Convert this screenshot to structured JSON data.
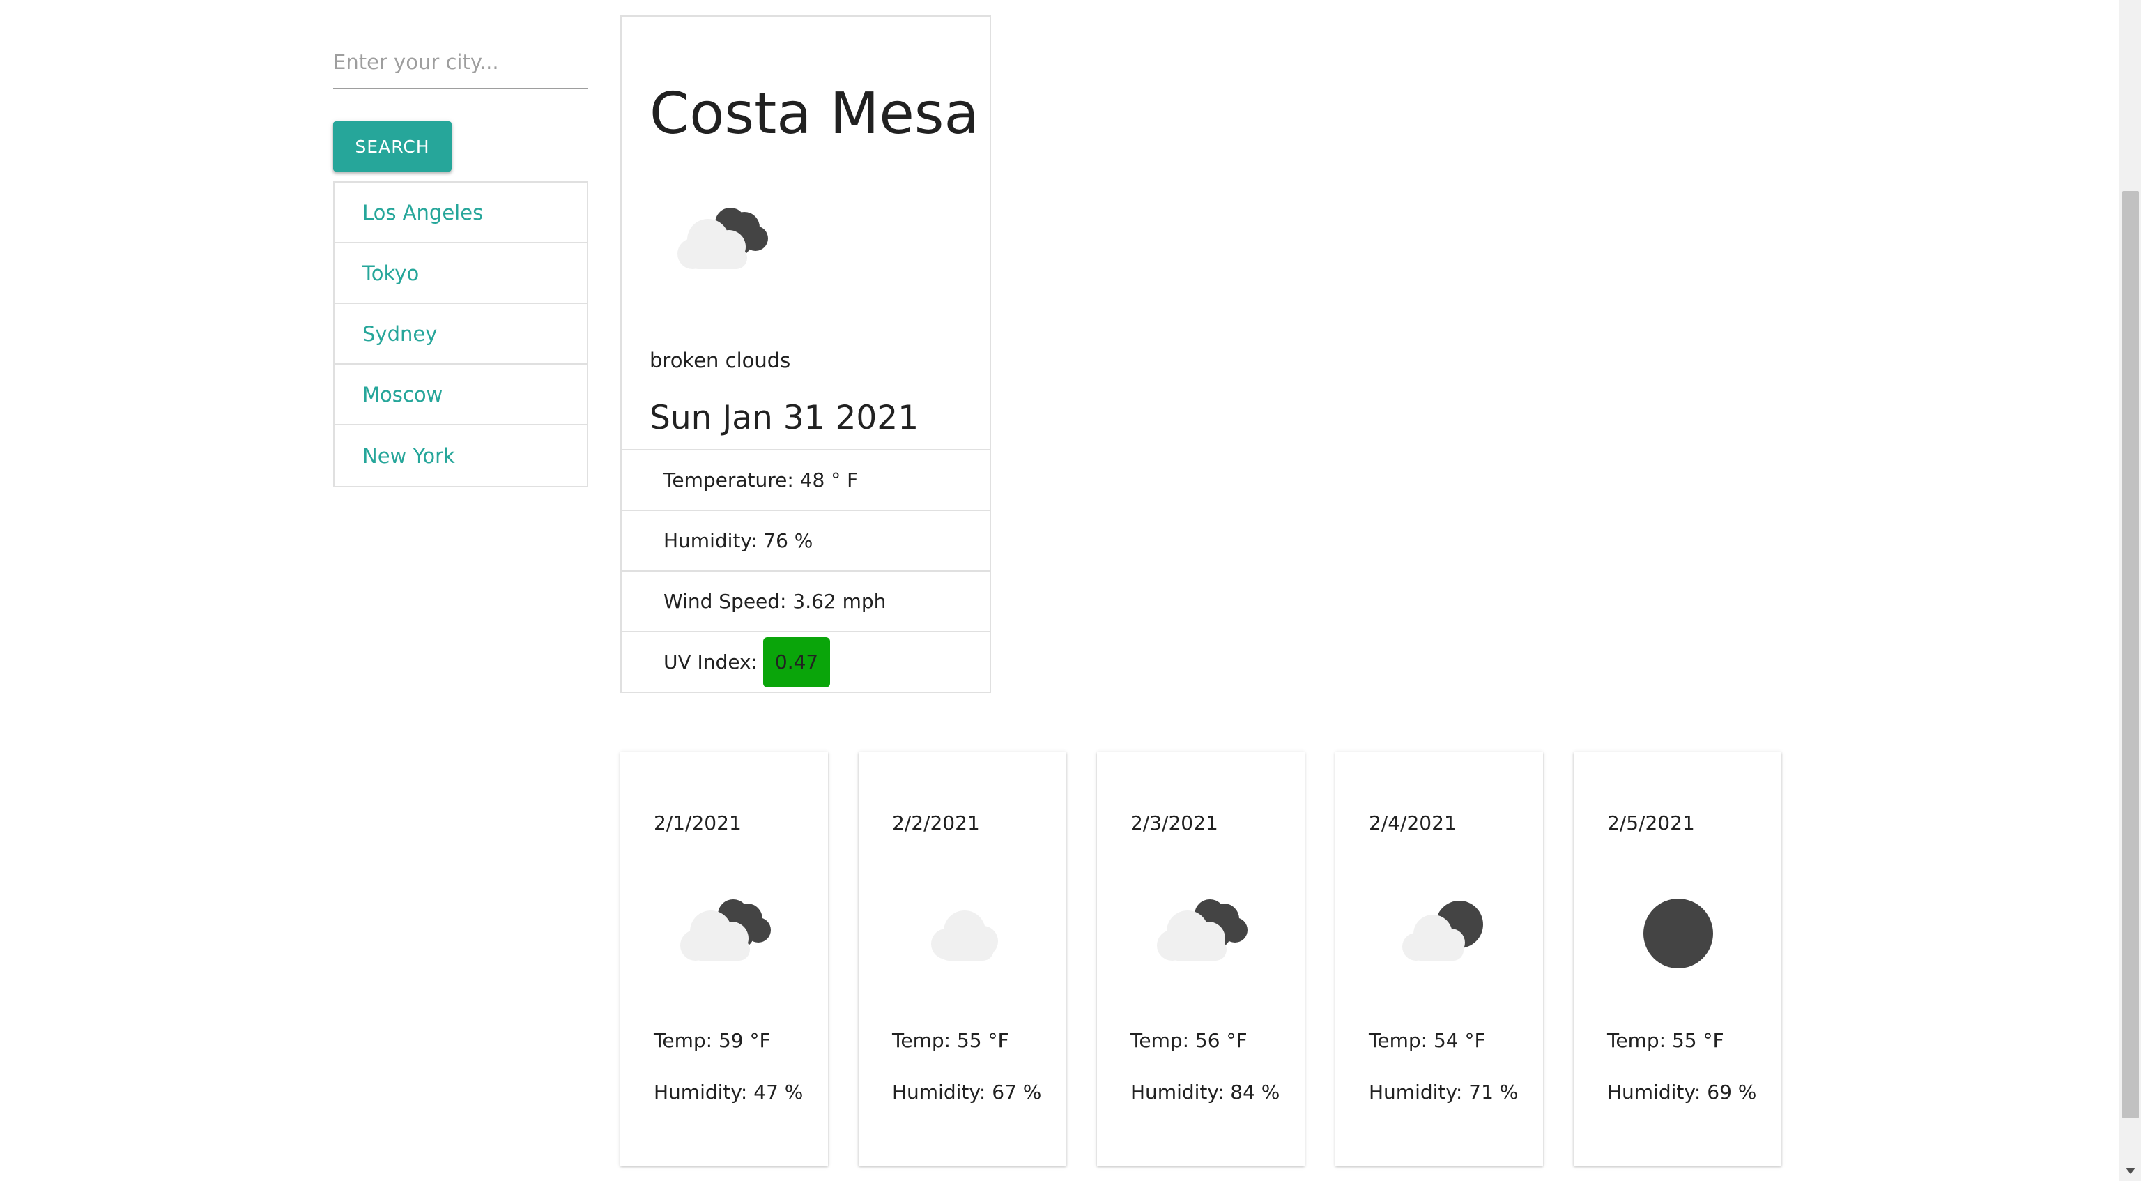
{
  "search": {
    "placeholder": "Enter your city...",
    "value": "",
    "button_label": "Search"
  },
  "history": [
    {
      "label": "Los Angeles"
    },
    {
      "label": "Tokyo"
    },
    {
      "label": "Sydney"
    },
    {
      "label": "Moscow"
    },
    {
      "label": "New York"
    }
  ],
  "current": {
    "city": "Costa Mesa",
    "icon": "broken-clouds-icon",
    "description": "broken clouds",
    "date": "Sun Jan 31 2021",
    "temperature": "Temperature: 48 ° F",
    "humidity": "Humidity: 76 %",
    "wind": "Wind Speed: 3.62 mph",
    "uv_label": "UV Index:",
    "uv_value": "0.47",
    "uv_color": "#0aa50a"
  },
  "forecast": [
    {
      "date": "2/1/2021",
      "icon": "broken-clouds-icon",
      "temp": "Temp: 59 °F",
      "humidity": "Humidity: 47 %"
    },
    {
      "date": "2/2/2021",
      "icon": "cloud-icon",
      "temp": "Temp: 55 °F",
      "humidity": "Humidity: 67 %"
    },
    {
      "date": "2/3/2021",
      "icon": "broken-clouds-icon",
      "temp": "Temp: 56 °F",
      "humidity": "Humidity: 84 %"
    },
    {
      "date": "2/4/2021",
      "icon": "partly-cloudy-icon",
      "temp": "Temp: 54 °F",
      "humidity": "Humidity: 71 %"
    },
    {
      "date": "2/5/2021",
      "icon": "clear-sky-icon",
      "temp": "Temp: 55 °F",
      "humidity": "Humidity: 69 %"
    }
  ],
  "colors": {
    "accent": "#26a69a",
    "uv_low": "#0aa50a"
  }
}
